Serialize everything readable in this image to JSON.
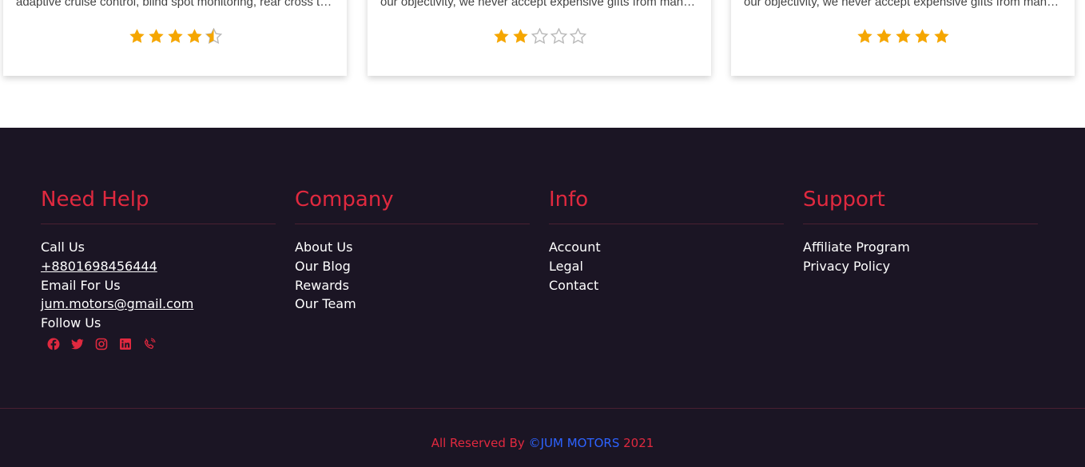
{
  "reviews": [
    {
      "text": "adaptive cruise control, blind spot monitoring, rear cross traffic alert...",
      "rating": 4.5
    },
    {
      "text": "our objectivity, we never accept expensive gifts from manufacturers...",
      "rating": 2
    },
    {
      "text": "our objectivity, we never accept expensive gifts from manufacturers...",
      "rating": 5
    }
  ],
  "colors": {
    "star": "#f5a600",
    "star_empty": "#b9b9b9",
    "accent": "#e0293f",
    "footer_bg": "#1b1524",
    "brand_blue": "#2d63ff"
  },
  "footer": {
    "need_help": {
      "title": "Need Help",
      "call_label": "Call Us",
      "phone": "+8801698456444",
      "email_label": "Email For Us",
      "email": "jum.motors@gmail.com",
      "follow_label": "Follow Us",
      "socials": [
        "facebook-icon",
        "twitter-icon",
        "instagram-icon",
        "linkedin-icon",
        "phone-icon"
      ]
    },
    "company": {
      "title": "Company",
      "items": [
        "About Us",
        "Our Blog",
        "Rewards",
        "Our Team"
      ]
    },
    "info": {
      "title": "Info",
      "items": [
        "Account",
        "Legal",
        "Contact"
      ]
    },
    "support": {
      "title": "Support",
      "items": [
        "Affiliate Program",
        "Privacy Policy"
      ]
    },
    "copyright": {
      "prefix": "All Reserved By ",
      "brand": "©JUM MOTORS",
      "suffix": " 2021"
    }
  }
}
